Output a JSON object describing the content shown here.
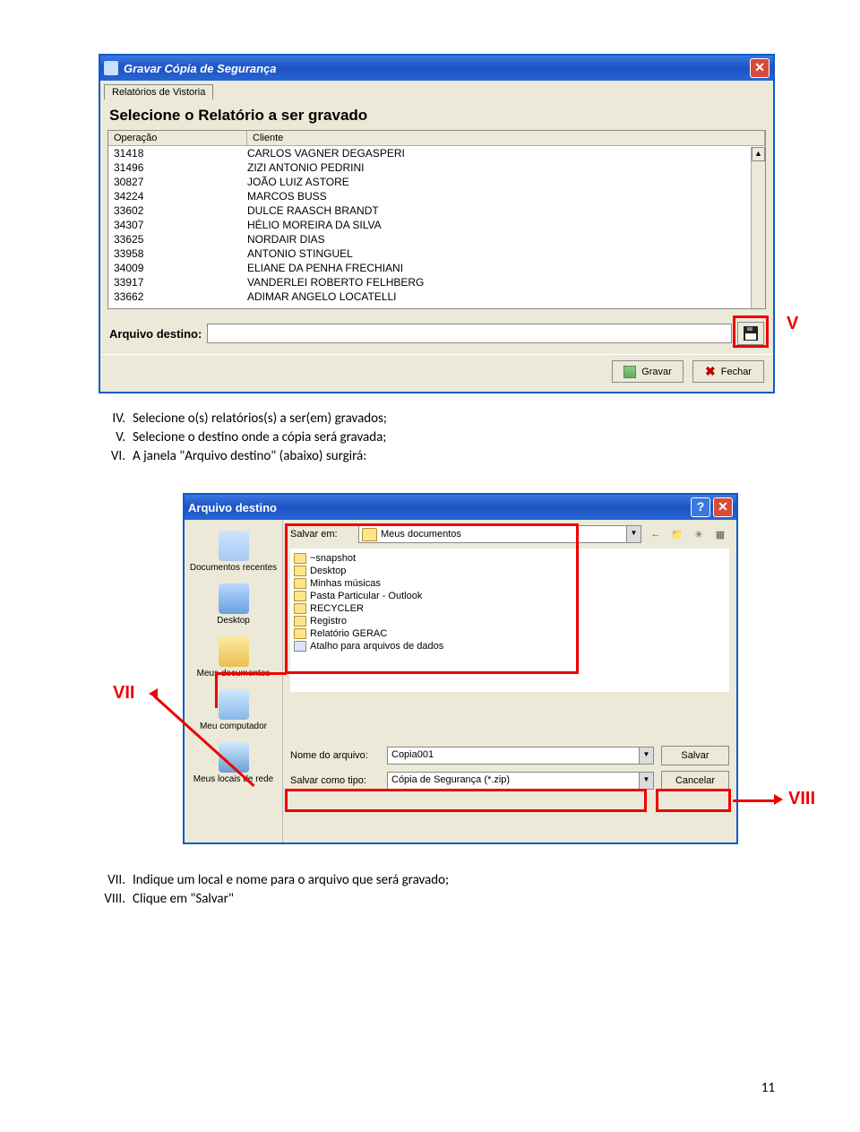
{
  "annotations": {
    "v": "V",
    "vii": "VII",
    "viii": "VIII"
  },
  "window1": {
    "title": "Gravar Cópia de Segurança",
    "tab": "Relatórios de Vistoria",
    "section_title": "Selecione o Relatório a ser gravado",
    "columns": {
      "op": "Operação",
      "cli": "Cliente"
    },
    "rows": [
      {
        "op": "31418",
        "cli": "CARLOS VAGNER DEGASPERI"
      },
      {
        "op": "31496",
        "cli": "ZIZI ANTONIO PEDRINI"
      },
      {
        "op": "30827",
        "cli": "JOÃO LUIZ ASTORE"
      },
      {
        "op": "34224",
        "cli": "MARCOS BUSS"
      },
      {
        "op": "33602",
        "cli": "DULCE RAASCH BRANDT"
      },
      {
        "op": "34307",
        "cli": "HÉLIO MOREIRA DA SILVA"
      },
      {
        "op": "33625",
        "cli": "NORDAIR DIAS"
      },
      {
        "op": "33958",
        "cli": "ANTONIO STINGUEL"
      },
      {
        "op": "34009",
        "cli": "ELIANE DA PENHA FRECHIANI"
      },
      {
        "op": "33917",
        "cli": "VANDERLEI ROBERTO FELHBERG"
      },
      {
        "op": "33662",
        "cli": "ADIMAR ANGELO LOCATELLI"
      }
    ],
    "dest_label": "Arquivo destino:",
    "btn_gravar": "Gravar",
    "btn_fechar": "Fechar"
  },
  "instructions1": [
    {
      "num": "IV.",
      "text": "Selecione o(s) relatórios(s) a ser(em) gravados;"
    },
    {
      "num": "V.",
      "text": "Selecione o destino onde a cópia será gravada;"
    },
    {
      "num": "VI.",
      "text": "A janela \"Arquivo destino\" (abaixo) surgirá:"
    }
  ],
  "window2": {
    "title": "Arquivo destino",
    "save_in_label": "Salvar em:",
    "save_in_value": "Meus documentos",
    "places": [
      {
        "label": "Documentos recentes",
        "cls": "recent"
      },
      {
        "label": "Desktop",
        "cls": "desk"
      },
      {
        "label": "Meus documentos",
        "cls": "mydoc"
      },
      {
        "label": "Meu computador",
        "cls": "mycomp"
      },
      {
        "label": "Meus locais de rede",
        "cls": "netw"
      }
    ],
    "files": [
      {
        "name": "~snapshot",
        "type": "folder"
      },
      {
        "name": "Desktop",
        "type": "folder"
      },
      {
        "name": "Minhas músicas",
        "type": "folder"
      },
      {
        "name": "Pasta Particular - Outlook",
        "type": "folder"
      },
      {
        "name": "RECYCLER",
        "type": "folder"
      },
      {
        "name": "Registro",
        "type": "folder"
      },
      {
        "name": "Relatório GERAC",
        "type": "folder"
      },
      {
        "name": "Atalho para arquivos de dados",
        "type": "link"
      }
    ],
    "filename_label": "Nome do arquivo:",
    "filename_value": "Copia001",
    "filetype_label": "Salvar como tipo:",
    "filetype_value": "Cópia de Segurança (*.zip)",
    "btn_save": "Salvar",
    "btn_cancel": "Cancelar"
  },
  "instructions2": [
    {
      "num": "VII.",
      "text": "Indique um local e nome para o arquivo que será gravado;"
    },
    {
      "num": "VIII.",
      "text": "Clique em \"Salvar\""
    }
  ],
  "page_number": "11"
}
